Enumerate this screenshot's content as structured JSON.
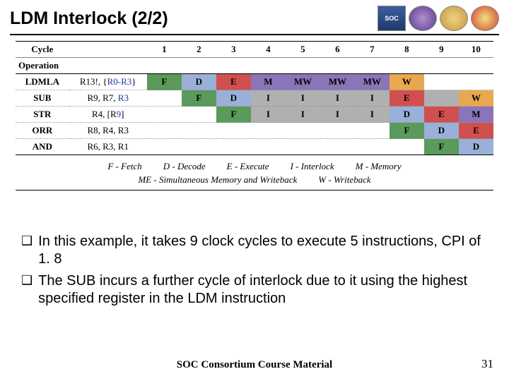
{
  "title": "LDM Interlock (2/2)",
  "table": {
    "cycle_label": "Cycle",
    "operation_label": "Operation",
    "cycles": [
      "1",
      "2",
      "3",
      "4",
      "5",
      "6",
      "7",
      "8",
      "9",
      "10"
    ],
    "rows": [
      {
        "mn": "LDMLA",
        "ops_pre": "R13!, {",
        "ops_blue": "R0-R3",
        "ops_post": "}",
        "cells": [
          {
            "t": "F",
            "c": "c-green"
          },
          {
            "t": "D",
            "c": "c-lblue"
          },
          {
            "t": "E",
            "c": "c-red"
          },
          {
            "t": "M",
            "c": "c-purple"
          },
          {
            "t": "MW",
            "c": "c-purple"
          },
          {
            "t": "MW",
            "c": "c-purple"
          },
          {
            "t": "MW",
            "c": "c-purple"
          },
          {
            "t": "W",
            "c": "c-orange"
          },
          {
            "t": "",
            "c": ""
          },
          {
            "t": "",
            "c": ""
          }
        ]
      },
      {
        "mn": "SUB",
        "ops_pre": "R9, R7, ",
        "ops_blue": "R3",
        "ops_post": "",
        "cells": [
          {
            "t": "",
            "c": ""
          },
          {
            "t": "F",
            "c": "c-green"
          },
          {
            "t": "D",
            "c": "c-lblue"
          },
          {
            "t": "I",
            "c": "c-gray"
          },
          {
            "t": "I",
            "c": "c-gray"
          },
          {
            "t": "I",
            "c": "c-gray"
          },
          {
            "t": "I",
            "c": "c-gray"
          },
          {
            "t": "E",
            "c": "c-red"
          },
          {
            "t": "",
            "c": "c-gray"
          },
          {
            "t": "W",
            "c": "c-orange"
          }
        ]
      },
      {
        "mn": "STR",
        "ops_pre": "R4, [R",
        "ops_blue": "9",
        "ops_post": "]",
        "cells": [
          {
            "t": "",
            "c": ""
          },
          {
            "t": "",
            "c": ""
          },
          {
            "t": "F",
            "c": "c-green"
          },
          {
            "t": "I",
            "c": "c-gray"
          },
          {
            "t": "I",
            "c": "c-gray"
          },
          {
            "t": "I",
            "c": "c-gray"
          },
          {
            "t": "I",
            "c": "c-gray"
          },
          {
            "t": "D",
            "c": "c-lblue"
          },
          {
            "t": "E",
            "c": "c-red"
          },
          {
            "t": "M",
            "c": "c-purple"
          }
        ]
      },
      {
        "mn": "ORR",
        "ops_pre": "R8, R4, R3",
        "ops_blue": "",
        "ops_post": "",
        "cells": [
          {
            "t": "",
            "c": ""
          },
          {
            "t": "",
            "c": ""
          },
          {
            "t": "",
            "c": ""
          },
          {
            "t": "",
            "c": ""
          },
          {
            "t": "",
            "c": ""
          },
          {
            "t": "",
            "c": ""
          },
          {
            "t": "",
            "c": ""
          },
          {
            "t": "F",
            "c": "c-green"
          },
          {
            "t": "D",
            "c": "c-lblue"
          },
          {
            "t": "E",
            "c": "c-red"
          }
        ]
      },
      {
        "mn": "AND",
        "ops_pre": "R6, R3, R1",
        "ops_blue": "",
        "ops_post": "",
        "cells": [
          {
            "t": "",
            "c": ""
          },
          {
            "t": "",
            "c": ""
          },
          {
            "t": "",
            "c": ""
          },
          {
            "t": "",
            "c": ""
          },
          {
            "t": "",
            "c": ""
          },
          {
            "t": "",
            "c": ""
          },
          {
            "t": "",
            "c": ""
          },
          {
            "t": "",
            "c": ""
          },
          {
            "t": "F",
            "c": "c-green"
          },
          {
            "t": "D",
            "c": "c-lblue"
          }
        ]
      }
    ]
  },
  "legend": {
    "l1a": "F - Fetch",
    "l1b": "D - Decode",
    "l1c": "E - Execute",
    "l1d": "I - Interlock",
    "l1e": "M - Memory",
    "l2a": "ME - Simultaneous Memory and Writeback",
    "l2b": "W - Writeback"
  },
  "bullets": [
    "In this example, it takes 9 clock cycles to execute 5 instructions, CPI of 1. 8",
    "The SUB incurs a further cycle of interlock due to it using the highest specified register in the LDM instruction"
  ],
  "footer": "SOC Consortium Course Material",
  "page": "31"
}
